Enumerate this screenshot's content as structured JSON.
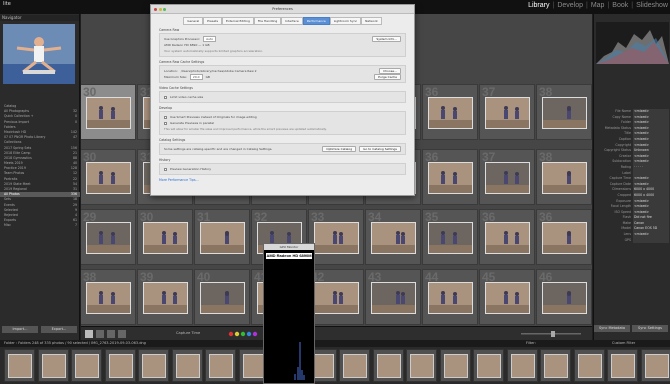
{
  "app": {
    "title": "lite"
  },
  "modules": [
    "Library",
    "Develop",
    "Map",
    "Book",
    "Slideshow"
  ],
  "active_module": "Library",
  "left_panel": {
    "header": "Navigator",
    "folders": [
      {
        "label": "Catalog",
        "count": ""
      },
      {
        "label": "All Photographs",
        "count": "32"
      },
      {
        "label": "Quick Collection +",
        "count": "0"
      },
      {
        "label": "Previous Import",
        "count": "0"
      },
      {
        "label": "Folders",
        "count": ""
      },
      {
        "label": "Macintosh HD",
        "count": "142"
      },
      {
        "label": "07 07 PNOR Photo Library",
        "count": "47"
      },
      {
        "label": "Collections",
        "count": ""
      },
      {
        "label": "2017 Spring Sets",
        "count": "156"
      },
      {
        "label": "2018 Elite Camp",
        "count": "21"
      },
      {
        "label": "2018 Gymnastics",
        "count": "88"
      },
      {
        "label": "Meets 2019",
        "count": "40"
      },
      {
        "label": "Practice 2019",
        "count": "128"
      },
      {
        "label": "Team Photos",
        "count": "12"
      },
      {
        "label": "Portraits",
        "count": "22"
      },
      {
        "label": "2019 State Meet",
        "count": "54"
      },
      {
        "label": "2019 Regional",
        "count": "31"
      },
      {
        "label": "All Photos",
        "count": "336"
      },
      {
        "label": "Sets",
        "count": "18"
      },
      {
        "label": "Events",
        "count": "29"
      },
      {
        "label": "Selected",
        "count": "9"
      },
      {
        "label": "Rejected",
        "count": "4"
      },
      {
        "label": "Exports",
        "count": "61"
      },
      {
        "label": "Misc",
        "count": "7"
      }
    ],
    "selected_index": 17,
    "import_button": "Import...",
    "export_button": "Export..."
  },
  "right_panel": {
    "metadata": [
      {
        "k": "File Name",
        "v": "<mixed>"
      },
      {
        "k": "Copy Name",
        "v": "<mixed>"
      },
      {
        "k": "Folder",
        "v": "<mixed>"
      },
      {
        "k": "Metadata Status",
        "v": "<mixed>"
      },
      {
        "k": "Title",
        "v": "<mixed>"
      },
      {
        "k": "Caption",
        "v": "<mixed>"
      },
      {
        "k": "Copyright",
        "v": "<mixed>"
      },
      {
        "k": "Copyright Status",
        "v": "Unknown"
      },
      {
        "k": "Creator",
        "v": "<mixed>"
      },
      {
        "k": "Sublocation",
        "v": "<mixed>"
      },
      {
        "k": "Rating",
        "v": "· · · · ·"
      },
      {
        "k": "Label",
        "v": ""
      },
      {
        "k": "Capture Time",
        "v": "<mixed>"
      },
      {
        "k": "Capture Date",
        "v": "<mixed>"
      },
      {
        "k": "Dimensions",
        "v": "6000 x 4000"
      },
      {
        "k": "Cropped",
        "v": "6000 x 4000"
      },
      {
        "k": "Exposure",
        "v": "<mixed>"
      },
      {
        "k": "Focal Length",
        "v": "<mixed>"
      },
      {
        "k": "ISO Speed",
        "v": "<mixed>"
      },
      {
        "k": "Flash",
        "v": "Did not fire"
      },
      {
        "k": "Make",
        "v": "Canon"
      },
      {
        "k": "Model",
        "v": "Canon EOS 5D"
      },
      {
        "k": "Lens",
        "v": "<mixed>"
      },
      {
        "k": "GPS",
        "v": ""
      }
    ],
    "sync_button": "Sync Metadata",
    "sync_settings_button": "Sync Settings"
  },
  "grid": {
    "row_numbers": [
      [
        30,
        31,
        32,
        33,
        34,
        35,
        36,
        37,
        38
      ],
      [
        29,
        30,
        31,
        32,
        33,
        34,
        35,
        36
      ],
      [
        38,
        39,
        40,
        41,
        42,
        43,
        44,
        45,
        46
      ]
    ],
    "toolbar_sort": "Capture Time"
  },
  "filmstrip": {
    "info": "Folder : Folders   248 of 335 photos / 90 selected / IMG_2763-2019-09-03-063.dng",
    "filter": "Filter:",
    "filter_value": "Custom Filter"
  },
  "dialog": {
    "title": "Preferences",
    "tabs": [
      "General",
      "Presets",
      "External Editing",
      "File Handling",
      "Interface",
      "Performance",
      "Lightroom Sync",
      "Network"
    ],
    "active_tab": "Performance",
    "camera_raw_section": "Camera Raw",
    "use_gpu_label": "Use Graphics Processor:",
    "use_gpu_value": "Auto",
    "system_info_button": "System Info...",
    "gpu_status": "AMD Radeon HD 6890 — 1 GB",
    "gpu_note": "Your system automatically supports limited graphics acceleration.",
    "cache_section": "Camera Raw Cache Settings",
    "cache_location_label": "Location:",
    "cache_location_value": "/Users/photo/Library/Caches/Adobe Camera Raw 2",
    "choose_button": "Choose...",
    "max_size_label": "Maximum Size:",
    "max_size_value": "20.0",
    "gb_label": "GB",
    "purge_button": "Purge Cache",
    "video_section": "Video Cache Settings",
    "video_note": "Limit video cache size",
    "develop_section": "Develop",
    "smart_previews_label": "Use Smart Previews instead of Originals for image editing",
    "generate_previews_label": "Generate Previews in parallel",
    "develop_note": "This will allow for smaller file sizes and improved performance, while the smart previews are updated automatically.",
    "catalog_section": "Catalog Settings",
    "catalog_note": "Some settings are catalog-specific and are changed in Catalog Settings.",
    "optimize_button": "Optimize Catalog",
    "goto_catalog_button": "Go to Catalog Settings",
    "history_section": "History",
    "history_note": "Preview Generation History",
    "link": "More Performance Tips..."
  },
  "monitor": {
    "title": "GPU Monitor",
    "headline": "AMD Radeon HD 6890M"
  }
}
